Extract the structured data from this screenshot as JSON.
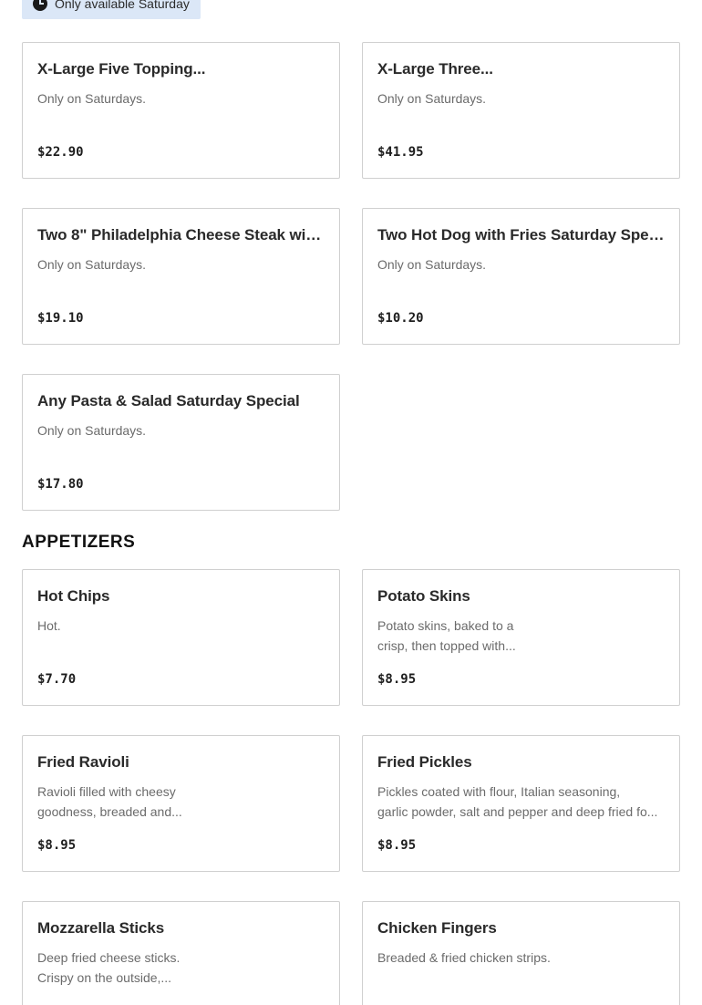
{
  "badge": {
    "icon": "clock-icon",
    "label": "Only available Saturday"
  },
  "saturday_items": [
    {
      "title": "X-Large Five Topping...",
      "desc": [
        "Only on Saturdays."
      ],
      "price": "$22.90"
    },
    {
      "title": "X-Large Three...",
      "desc": [
        "Only on Saturdays."
      ],
      "price": "$41.95"
    },
    {
      "title": "Two 8\" Philadelphia Cheese Steak with...",
      "desc": [
        "Only on Saturdays."
      ],
      "price": "$19.10"
    },
    {
      "title": "Two Hot Dog with Fries Saturday Special",
      "desc": [
        "Only on Saturdays."
      ],
      "price": "$10.20"
    },
    {
      "title": "Any Pasta & Salad Saturday Special",
      "desc": [
        "Only on Saturdays."
      ],
      "price": "$17.80"
    }
  ],
  "appetizers": {
    "heading": "APPETIZERS",
    "items": [
      {
        "title": "Hot Chips",
        "desc": [
          "Hot."
        ],
        "price": "$7.70"
      },
      {
        "title": "Potato Skins",
        "desc": [
          "Potato skins, baked to a",
          "crisp, then topped with..."
        ],
        "price": "$8.95"
      },
      {
        "title": "Fried Ravioli",
        "desc": [
          "Ravioli filled with cheesy",
          "goodness, breaded and..."
        ],
        "price": "$8.95"
      },
      {
        "title": "Fried Pickles",
        "desc": [
          "Pickles coated with flour, Italian seasoning,",
          "garlic powder, salt and pepper and deep fried fo..."
        ],
        "price": "$8.95"
      },
      {
        "title": "Mozzarella Sticks",
        "desc": [
          "Deep fried cheese sticks.",
          "Crispy on the outside,..."
        ],
        "price": ""
      },
      {
        "title": "Chicken Fingers",
        "desc": [
          "Breaded & fried chicken strips."
        ],
        "price": ""
      }
    ]
  }
}
